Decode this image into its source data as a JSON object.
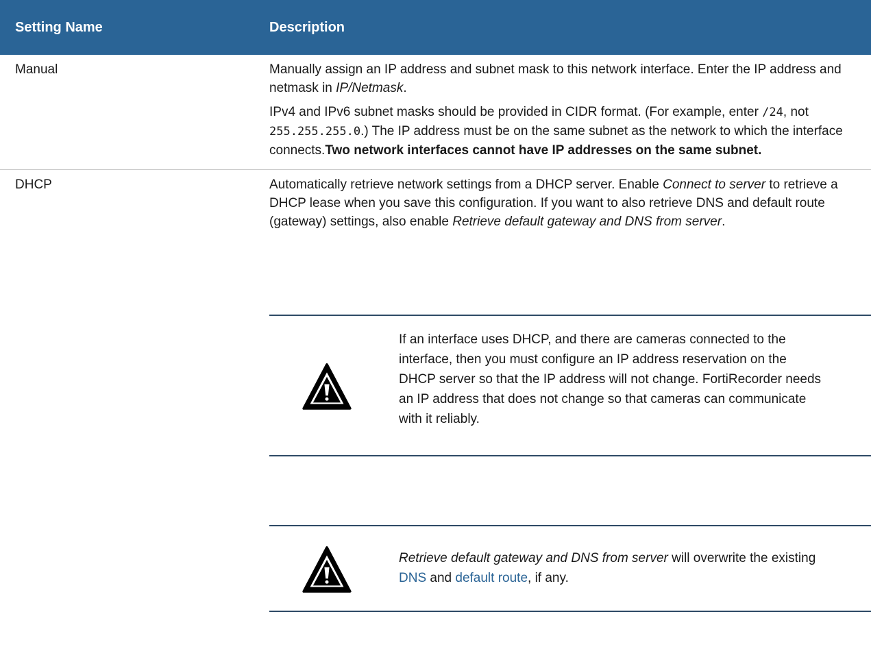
{
  "table": {
    "header": {
      "col1": "Setting Name",
      "col2": "Description"
    },
    "rows": [
      {
        "name": "Manual",
        "p1_a": "Manually assign an IP address and subnet mask to this network interface. Enter the IP address and netmask in ",
        "p1_em": "IP/Netmask",
        "p1_b": ".",
        "p2_a": "IPv4 and IPv6 subnet masks should be provided in CIDR format. (For example, enter ",
        "p2_code1": "/24",
        "p2_b": ", not ",
        "p2_code2": "255.255.255.0",
        "p2_c": ".) The IP address must be on the same subnet as the network to which the interface connects.",
        "p2_strong": "Two network interfaces cannot have IP addresses on the same subnet."
      },
      {
        "name": "DHCP",
        "t1": "Automatically retrieve network settings from a DHCP server. Enable ",
        "em1": "Connect to server",
        "t2": " to retrieve a DHCP lease when you save this configuration. If you want to also retrieve DNS and default route (gateway) settings, also enable ",
        "em2": "Retrieve default gateway and DNS from server",
        "t3": "."
      }
    ]
  },
  "notes": [
    {
      "icon": "warning-icon",
      "text": "If an interface uses DHCP, and there are cameras connected to the interface, then you must configure an IP address reservation on the DHCP server so that the IP address will not change. FortiRecorder needs an IP address that does not change so that cameras can communicate with it reliably."
    },
    {
      "icon": "warning-icon",
      "em": "Retrieve default gateway and DNS from server",
      "t1": " will overwrite the existing ",
      "link1": "DNS",
      "t2": " and ",
      "link2": "default route",
      "t3": ", if any."
    }
  ],
  "colors": {
    "header_bg": "#2a6496",
    "header_text": "#ffffff",
    "link": "#2a6496",
    "note_rule": "#2e4a66"
  }
}
